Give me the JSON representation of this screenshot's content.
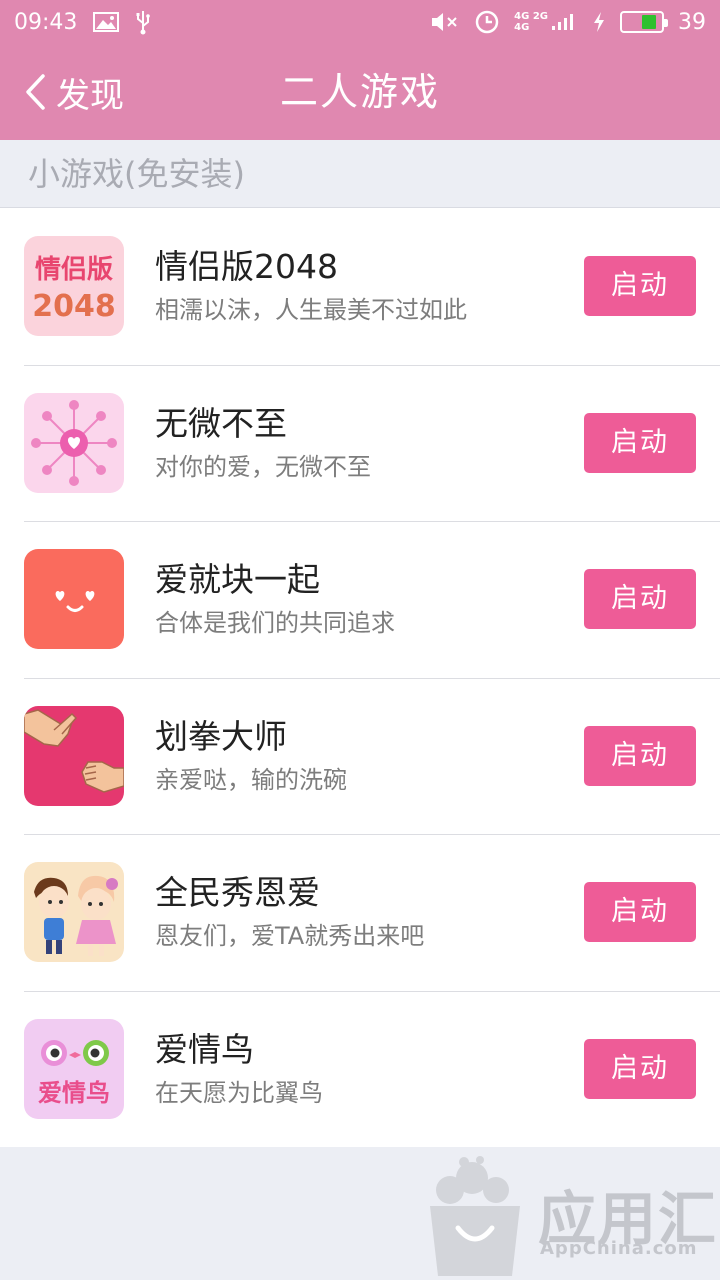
{
  "status_bar": {
    "time": "09:43",
    "network_top": "4G 2G",
    "network_bottom": "4G",
    "battery_level": "39"
  },
  "nav": {
    "back_label": "发现",
    "title": "二人游戏"
  },
  "section": {
    "title": "小游戏(免安装)"
  },
  "games": [
    {
      "name": "情侣版2048",
      "desc": "相濡以沫，人生最美不过如此",
      "button": "启动",
      "icon_text_top": "情侣版",
      "icon_text_bottom": "2048"
    },
    {
      "name": "无微不至",
      "desc": "对你的爱，无微不至",
      "button": "启动"
    },
    {
      "name": "爱就块一起",
      "desc": "合体是我们的共同追求",
      "button": "启动"
    },
    {
      "name": "划拳大师",
      "desc": "亲爱哒，输的洗碗",
      "button": "启动"
    },
    {
      "name": "全民秀恩爱",
      "desc": "恩友们，爱TA就秀出来吧",
      "button": "启动"
    },
    {
      "name": "爱情鸟",
      "desc": "在天愿为比翼鸟",
      "button": "启动",
      "icon_text": "爱情鸟"
    }
  ],
  "watermark": {
    "title": "应用汇",
    "subtitle": "AppChina.com"
  },
  "colors": {
    "header": "#e088b0",
    "button": "#ee5c97",
    "background": "#eceef4"
  }
}
